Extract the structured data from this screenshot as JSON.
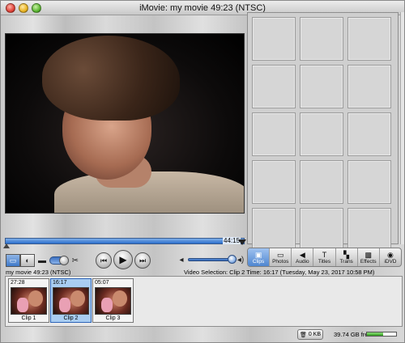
{
  "window": {
    "title": "iMovie: my movie  49:23 (NTSC)"
  },
  "monitor": {
    "playhead_timecode": "44:15"
  },
  "controls": {
    "clip_mode_icon": "clip-viewer-icon",
    "timeline_mode_icon": "timeline-viewer-icon",
    "camera_icon": "camera-icon",
    "edit_icon": "scissors-icon",
    "rewind_glyph": "⏮",
    "play_glyph": "▶",
    "fullscreen_glyph": "⏭",
    "volume_low_glyph": "◂",
    "volume_high_glyph": "◂)",
    "volume_level": 0.9
  },
  "tabs": [
    {
      "label": "Clips",
      "icon": "▣",
      "active": true
    },
    {
      "label": "Photos",
      "icon": "▭",
      "active": false
    },
    {
      "label": "Audio",
      "icon": "◀",
      "active": false
    },
    {
      "label": "Titles",
      "icon": "T",
      "active": false
    },
    {
      "label": "Trans",
      "icon": "▚",
      "active": false
    },
    {
      "label": "Effects",
      "icon": "▩",
      "active": false
    },
    {
      "label": "iDVD",
      "icon": "◉",
      "active": false
    }
  ],
  "info": {
    "project": "my movie  49:23 (NTSC)",
    "selection": "Video Selection: Clip 2 Time: 16:17 (Tuesday, May 23, 2017 10:58 PM)"
  },
  "clips": [
    {
      "duration": "27:28",
      "label": "Clip 1",
      "selected": false
    },
    {
      "duration": "16:17",
      "label": "Clip 2",
      "selected": true
    },
    {
      "duration": "05:07",
      "label": "Clip 3",
      "selected": false
    }
  ],
  "status": {
    "trash_size": "0 KB",
    "free_space": "39.74 GB free",
    "free_fraction": 0.55
  },
  "colors": {
    "accent": "#3f79c9",
    "free_bar": "#2f9c1c"
  }
}
